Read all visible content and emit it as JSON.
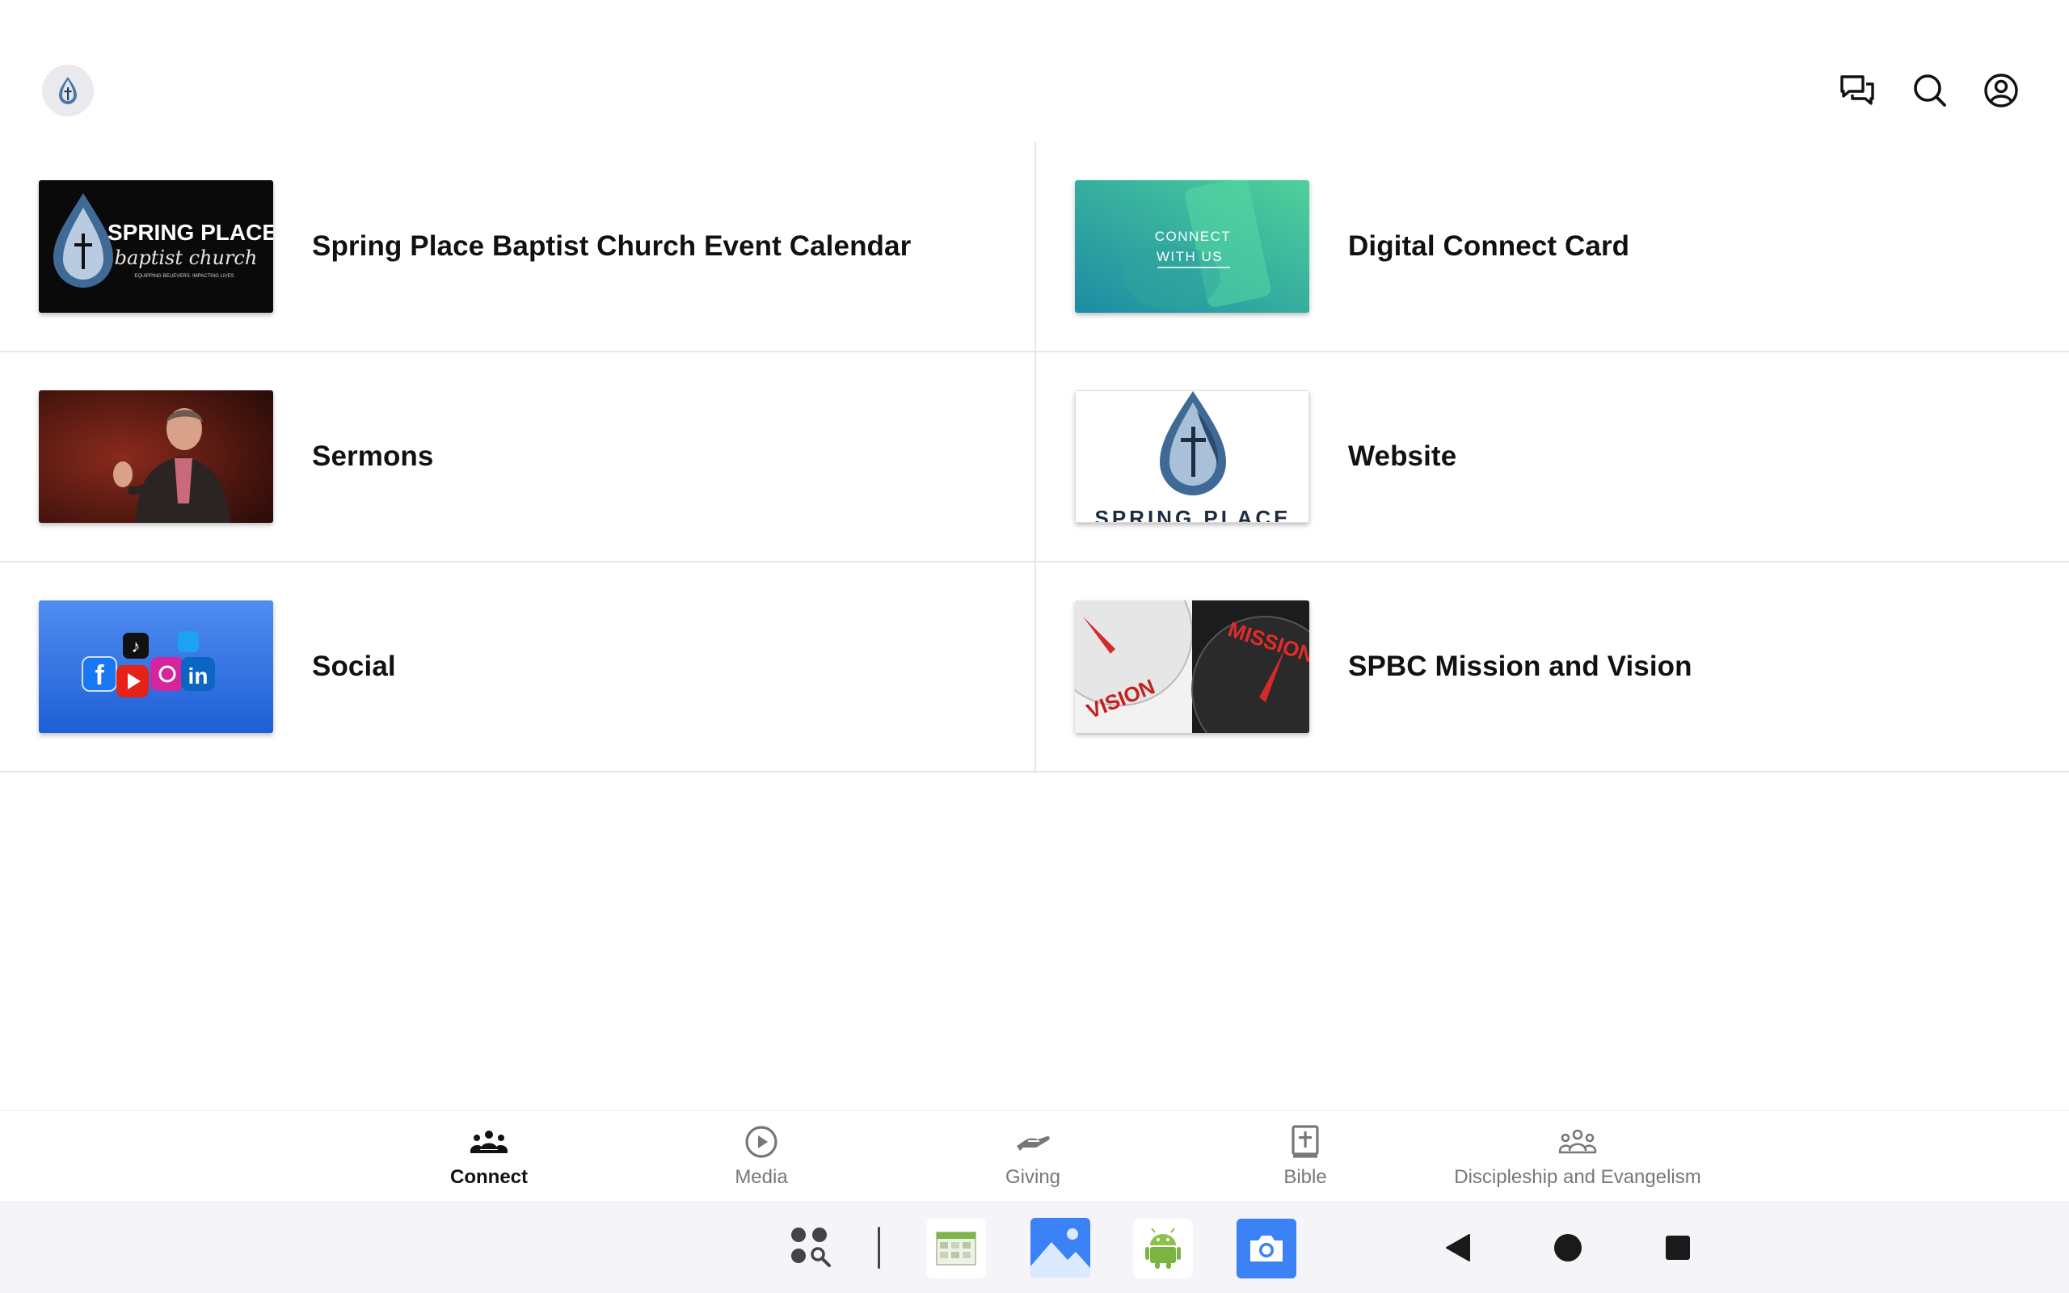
{
  "colors": {
    "accent": "#111111",
    "inactive": "#777777",
    "divider": "#e6e6e6",
    "brand_blue": "#4a78a8"
  },
  "header": {
    "logo_icon": "spring-place-drop-logo",
    "actions": [
      {
        "name": "messages-icon"
      },
      {
        "name": "search-icon"
      },
      {
        "name": "account-icon"
      }
    ]
  },
  "grid": {
    "items": [
      {
        "label": "Spring Place Baptist Church Event Calendar",
        "thumb_text": {
          "line1": "SPRING PLACE",
          "line2": "baptist church",
          "line3": "EQUIPPING BELIEVERS. IMPACTING LIVES"
        }
      },
      {
        "label": "Digital Connect Card",
        "thumb_text": {
          "line1": "CONNECT",
          "line2": "WITH US"
        }
      },
      {
        "label": "Sermons"
      },
      {
        "label": "Website",
        "thumb_text": {
          "line1": "SPRING PLACE"
        }
      },
      {
        "label": "Social"
      },
      {
        "label": "SPBC Mission and Vision",
        "thumb_text": {
          "line1": "VISION",
          "line2": "MISSION"
        }
      }
    ]
  },
  "tabs": [
    {
      "label": "Connect",
      "icon": "people-group-icon",
      "active": true
    },
    {
      "label": "Media",
      "icon": "play-circle-icon",
      "active": false
    },
    {
      "label": "Giving",
      "icon": "giving-hand-icon",
      "active": false
    },
    {
      "label": "Bible",
      "icon": "bible-icon",
      "active": false
    },
    {
      "label": "Discipleship and Evangelism",
      "icon": "people-group-outline-icon",
      "active": false
    }
  ],
  "system_bar": {
    "apps": [
      "app-search-icon",
      "calendar-app-icon",
      "gallery-app-icon",
      "android-app-icon",
      "camera-app-icon"
    ],
    "nav": [
      "back-icon",
      "home-icon",
      "recents-icon"
    ]
  }
}
